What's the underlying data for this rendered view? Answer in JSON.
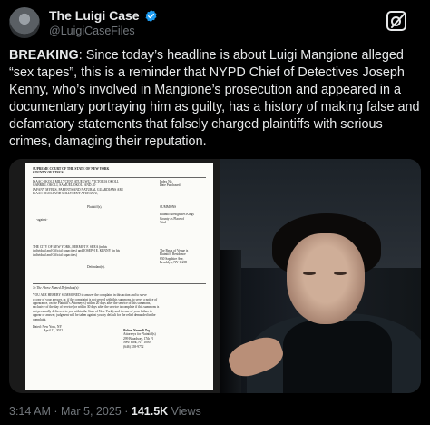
{
  "account": {
    "display_name": "The Luigi Case",
    "handle": "@LuigiCaseFiles",
    "verified_icon": "verified-badge-icon",
    "grok_icon": "grok-icon"
  },
  "post": {
    "lead": "BREAKING",
    "body": ": Since today’s headline is about Luigi Mangione alleged “sex tapes”, this is a reminder that NYPD Chief of Detectives Joseph Kenny, who’s involved in Mangione’s prosecution and appeared in a documentary portraying him as guilty, has a history of making false and defamatory statements that falsely charged plaintiffs with serious crimes, damaging their reputation."
  },
  "document": {
    "court_1": "SUPREME COURT OF THE STATE OF NEW YORK",
    "court_2": "COUNTY OF KINGS",
    "index_label": "Index No.",
    "date_purchased": "Date Purchased:",
    "plaintiffs_1": "ISAAC OKOLI, MILLYCENT ATUEGWU, VICTORIA OKOLI,",
    "plaintiffs_2": "GABRIEL OKOLI, SAMUEL OKOLI AND JO",
    "plaintiffs_3": "JAFANY MYERS, PARENTS AND NATURAL GUARDIANS ARE",
    "plaintiffs_4": "ISAAC OKOLI AND MILLYCENT ATUEGWU,",
    "plaintiffs_label": "Plaintiff(s),",
    "against": "-against-",
    "summons": "SUMMONS",
    "venue_1": "Plaintiff Designates Kings",
    "venue_2": "County as Place of",
    "venue_3": "Trial",
    "defendants_1": "THE CITY OF NEW YORK, DERMOT F. SHEA (in his",
    "defendants_2": "individual and Official capacities) and JOSEPH E. KENNY (in his",
    "defendants_3": "individual and Official capacities)",
    "basis_1": "The Basis of Venue is",
    "basis_2": "Plaintiffs Residence",
    "address_1": "630 Sapphire Ave,",
    "address_2": "Brooklyn, NY 11208",
    "defendants_label": "Defendant(s).",
    "to_line": "To The Above Named Defendant(s):",
    "summoned_1": "YOU ARE HEREBY SUMMONED to answer the complaint in this action and to serve",
    "summoned_2": "a copy of your answer, or, if the complaint is not served with this summons, to serve a notice of",
    "summoned_3": "appearance, on the Plaintiff's Attorney(s) within 20 days after the service of this summons,",
    "summoned_4": "exclusive of the day of service (or within 30 days after the service is complete if this summons is",
    "summoned_5": "not personally delivered to you within the State of New York); and in case of your failure to",
    "summoned_6": "appear or answer, judgment will be taken against you by default for the relief demanded in the",
    "summoned_7": "complaint.",
    "dated_1": "Dated: New York, NY",
    "dated_2": "April 12, 2022",
    "attorney_1": "Robert Nnamdi Tsq",
    "attorney_2": "Attorneys for Plaintiff(s)",
    "attorney_3": "299 Broadway, 17th Fl",
    "attorney_4": "New York, NY 10007",
    "attorney_5": "(646) 358-9772"
  },
  "meta": {
    "time": "3:14 AM",
    "date": "Mar 5, 2025",
    "separator": "·",
    "views_count": "141.5K",
    "views_label": "Views"
  }
}
